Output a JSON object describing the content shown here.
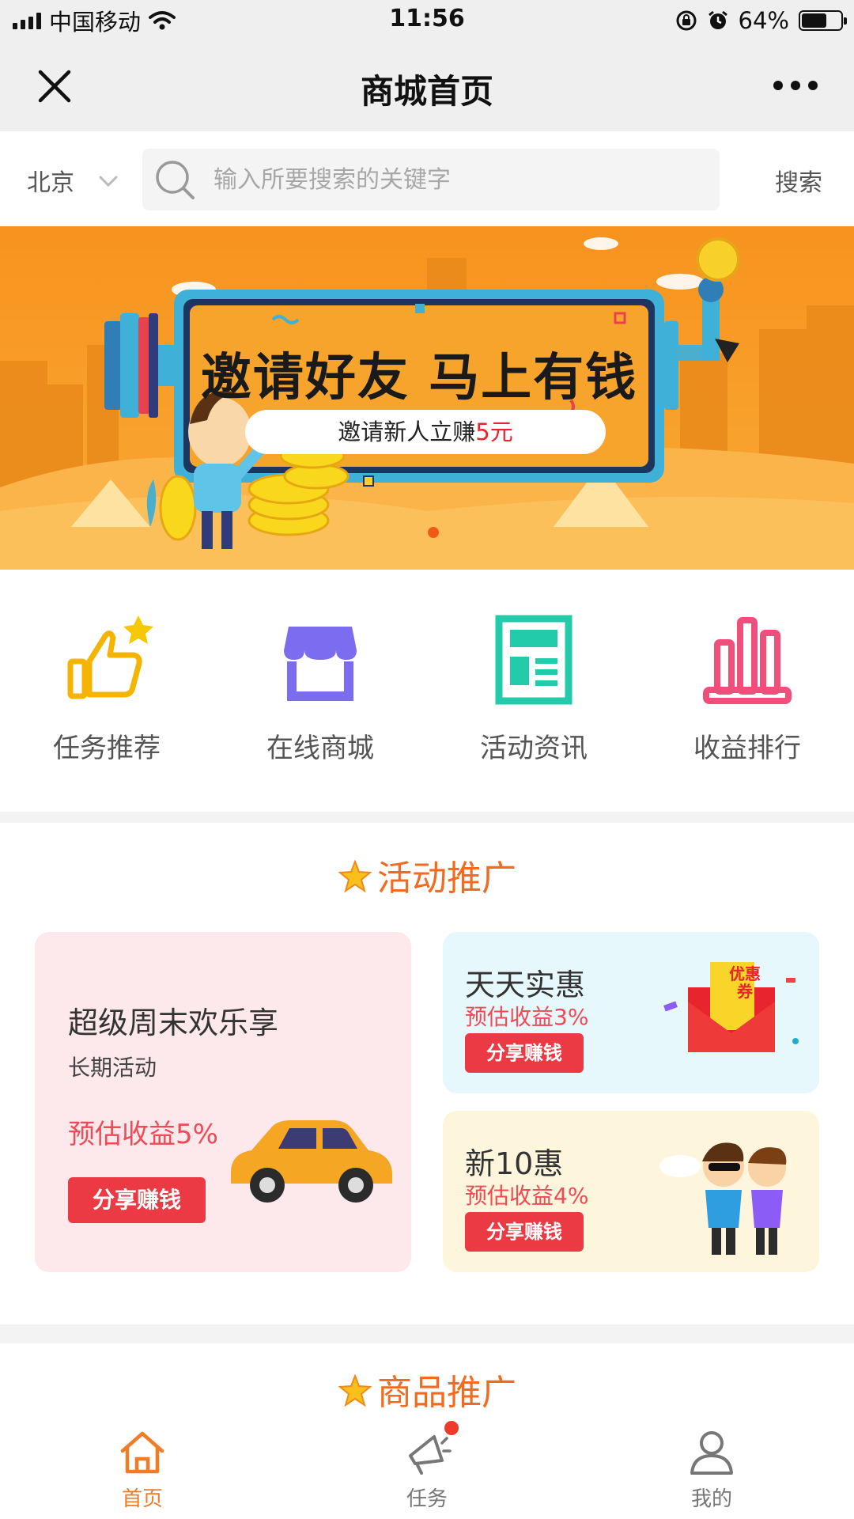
{
  "status_bar": {
    "carrier": "中国移动",
    "time": "11:56",
    "battery_percent": "64%",
    "battery_level": 0.64
  },
  "nav": {
    "title": "商城首页",
    "close_icon": "close-icon",
    "more_icon": "more-dots-icon"
  },
  "search": {
    "city": "北京",
    "placeholder": "输入所要搜索的关键字",
    "button": "搜索"
  },
  "banner": {
    "title": "邀请好友 马上有钱",
    "pill_prefix": "邀请新人立赚",
    "pill_amount": "5元",
    "slide_count": 1,
    "active_slide": 1
  },
  "categories": [
    {
      "label": "任务推荐",
      "icon": "thumbs-up-star-icon",
      "color": "#f5b400"
    },
    {
      "label": "在线商城",
      "icon": "shop-icon",
      "color": "#7c6cf0"
    },
    {
      "label": "活动资讯",
      "icon": "news-icon",
      "color": "#22ccaa"
    },
    {
      "label": "收益排行",
      "icon": "bar-chart-icon",
      "color": "#ef4f7a"
    }
  ],
  "activity_section": {
    "title": "活动推广",
    "cards": [
      {
        "title": "超级周末欢乐享",
        "subtitle": "长期活动",
        "earn": "预估收益5%",
        "button": "分享赚钱"
      },
      {
        "title": "天天实惠",
        "earn": "预估收益3%",
        "button": "分享赚钱",
        "coupon_text": "优惠券"
      },
      {
        "title": "新10惠",
        "earn": "预估收益4%",
        "button": "分享赚钱"
      }
    ]
  },
  "product_section": {
    "title": "商品推广"
  },
  "tab_bar": {
    "tabs": [
      {
        "label": "首页",
        "icon": "home-icon",
        "active": true
      },
      {
        "label": "任务",
        "icon": "megaphone-icon",
        "active": false,
        "badge": true
      },
      {
        "label": "我的",
        "icon": "user-icon",
        "active": false
      }
    ]
  },
  "colors": {
    "accent": "#f26b21",
    "banner": "#f7931e",
    "cta_red": "#ec3a45",
    "tab_active": "#f07c26"
  }
}
